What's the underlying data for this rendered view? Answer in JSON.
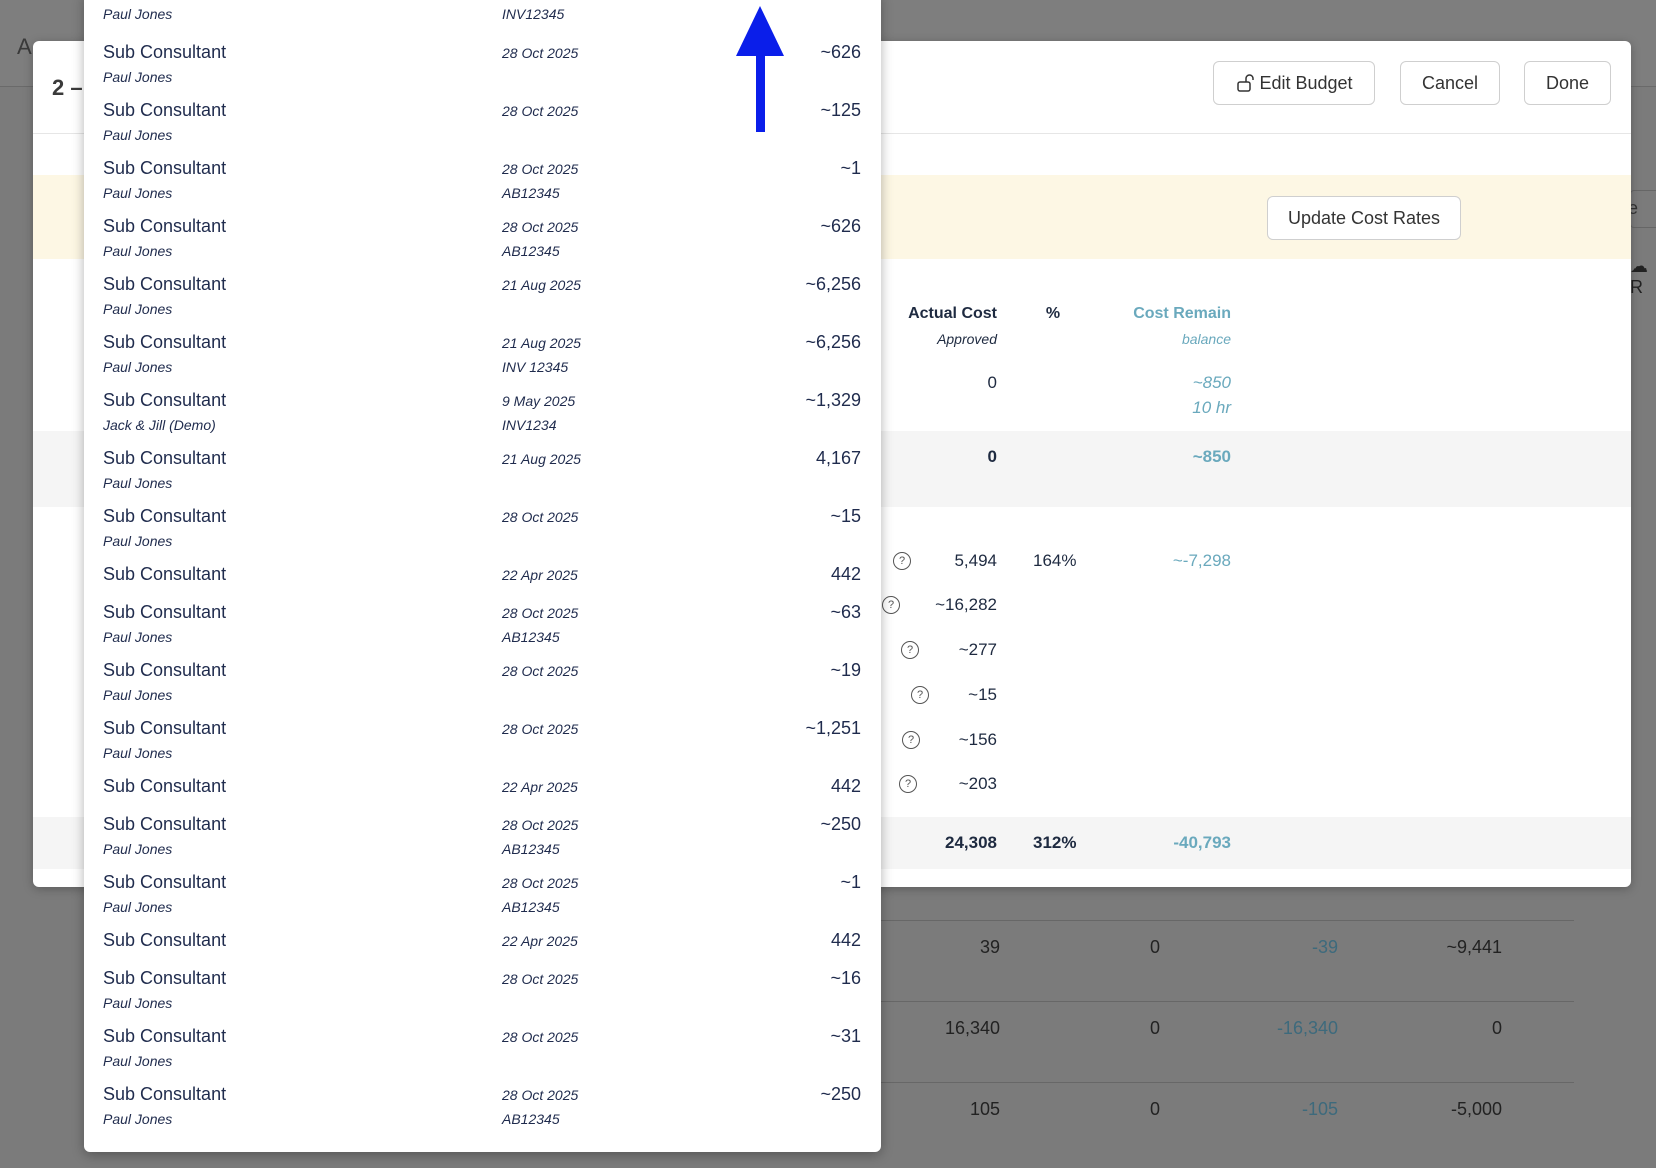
{
  "background": {
    "header_letter": "A",
    "right_edge_text": "e",
    "right_edge_icon_label": "R",
    "rows": [
      {
        "c1": "39",
        "c2": "0",
        "c3": "-39",
        "c4": "~9,441"
      },
      {
        "c1": "16,340",
        "c2": "0",
        "c3": "-16,340",
        "c4": "0"
      },
      {
        "c1": "105",
        "c2": "0",
        "c3": "-105",
        "c4": "-5,000"
      }
    ]
  },
  "modal": {
    "title": "2 –",
    "edit_budget_label": "Edit Budget",
    "cancel_label": "Cancel",
    "done_label": "Done",
    "update_cost_rates_label": "Update Cost Rates",
    "columns": {
      "actual_cost": "Actual Cost",
      "actual_cost_sub": "Approved",
      "percent": "%",
      "cost_remain": "Cost Remain",
      "cost_remain_sub": "balance"
    },
    "row1": {
      "actual": "0",
      "remain": "~850",
      "remain_hours": "10 hr"
    },
    "subtotal1": {
      "actual": "0",
      "remain": "~850"
    },
    "detail_rows": [
      {
        "actual": "5,494",
        "percent": "164%",
        "remain": "~-7,298"
      },
      {
        "actual": "~16,282"
      },
      {
        "actual": "~277"
      },
      {
        "actual": "~15"
      },
      {
        "actual": "~156"
      },
      {
        "actual": "~203"
      }
    ],
    "total": {
      "actual": "24,308",
      "percent": "312%",
      "remain": "-40,793"
    }
  },
  "dropdown": {
    "top_partial": {
      "person": "Paul Jones",
      "ref": "INV12345"
    },
    "items": [
      {
        "type": "Sub Consultant",
        "date": "28 Oct 2025",
        "amount": "~626",
        "person": "Paul Jones",
        "ref": ""
      },
      {
        "type": "Sub Consultant",
        "date": "28 Oct 2025",
        "amount": "~125",
        "person": "Paul Jones",
        "ref": ""
      },
      {
        "type": "Sub Consultant",
        "date": "28 Oct 2025",
        "amount": "~1",
        "person": "Paul Jones",
        "ref": "AB12345"
      },
      {
        "type": "Sub Consultant",
        "date": "28 Oct 2025",
        "amount": "~626",
        "person": "Paul Jones",
        "ref": "AB12345"
      },
      {
        "type": "Sub Consultant",
        "date": "21 Aug 2025",
        "amount": "~6,256",
        "person": "Paul Jones",
        "ref": ""
      },
      {
        "type": "Sub Consultant",
        "date": "21 Aug 2025",
        "amount": "~6,256",
        "person": "Paul Jones",
        "ref": "INV 12345"
      },
      {
        "type": "Sub Consultant",
        "date": "9 May 2025",
        "amount": "~1,329",
        "person": "Jack & Jill (Demo)",
        "ref": "INV1234"
      },
      {
        "type": "Sub Consultant",
        "date": "21 Aug 2025",
        "amount": "4,167",
        "person": "Paul Jones",
        "ref": ""
      },
      {
        "type": "Sub Consultant",
        "date": "28 Oct 2025",
        "amount": "~15",
        "person": "Paul Jones",
        "ref": ""
      },
      {
        "type": "Sub Consultant",
        "date": "22 Apr 2025",
        "amount": "442",
        "person": "",
        "ref": ""
      },
      {
        "type": "Sub Consultant",
        "date": "28 Oct 2025",
        "amount": "~63",
        "person": "Paul Jones",
        "ref": "AB12345"
      },
      {
        "type": "Sub Consultant",
        "date": "28 Oct 2025",
        "amount": "~19",
        "person": "Paul Jones",
        "ref": ""
      },
      {
        "type": "Sub Consultant",
        "date": "28 Oct 2025",
        "amount": "~1,251",
        "person": "Paul Jones",
        "ref": ""
      },
      {
        "type": "Sub Consultant",
        "date": "22 Apr 2025",
        "amount": "442",
        "person": "",
        "ref": ""
      },
      {
        "type": "Sub Consultant",
        "date": "28 Oct 2025",
        "amount": "~250",
        "person": "Paul Jones",
        "ref": "AB12345"
      },
      {
        "type": "Sub Consultant",
        "date": "28 Oct 2025",
        "amount": "~1",
        "person": "Paul Jones",
        "ref": "AB12345"
      },
      {
        "type": "Sub Consultant",
        "date": "22 Apr 2025",
        "amount": "442",
        "person": "",
        "ref": ""
      },
      {
        "type": "Sub Consultant",
        "date": "28 Oct 2025",
        "amount": "~16",
        "person": "Paul Jones",
        "ref": ""
      },
      {
        "type": "Sub Consultant",
        "date": "28 Oct 2025",
        "amount": "~31",
        "person": "Paul Jones",
        "ref": ""
      },
      {
        "type": "Sub Consultant",
        "date": "28 Oct 2025",
        "amount": "~250",
        "person": "Paul Jones",
        "ref": "AB12345"
      }
    ]
  },
  "annotation": {
    "icon": "up-arrow-icon",
    "color": "#0a1eea"
  },
  "colors": {
    "teal": "#6aa9bd",
    "yellow_band": "#fdf7e4",
    "navy_text": "#1f2b4d"
  }
}
